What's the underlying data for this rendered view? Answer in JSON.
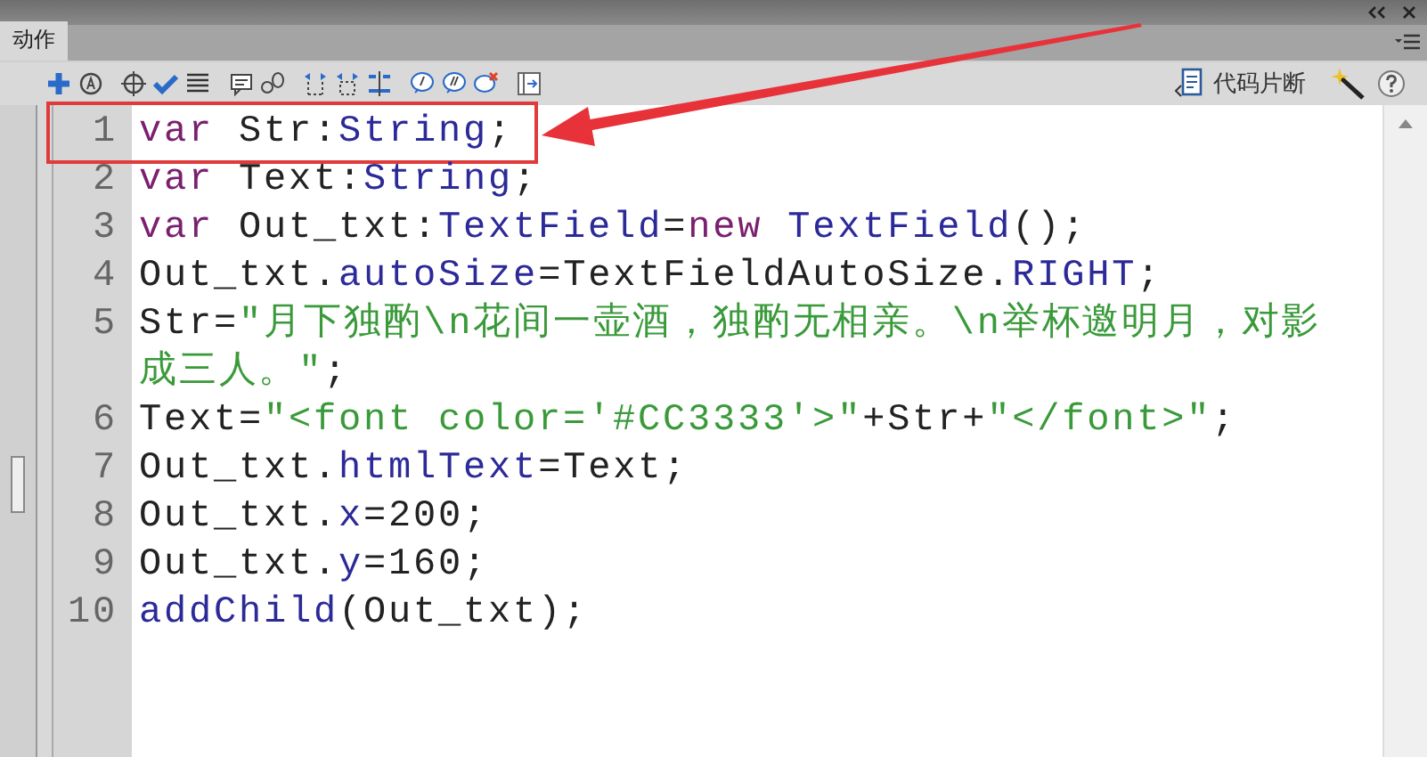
{
  "panel": {
    "tabs": [
      {
        "label": "动作",
        "selected": true
      }
    ]
  },
  "toolbar": {
    "snippets_label": "代码片断"
  },
  "editor": {
    "lines": [
      {
        "number": "1",
        "highlighted": true,
        "tokens": [
          {
            "kind": "keyword",
            "text": "var"
          },
          {
            "kind": "plain",
            "text": " Str:"
          },
          {
            "kind": "type",
            "text": "String"
          },
          {
            "kind": "plain",
            "text": ";"
          }
        ]
      },
      {
        "number": "2",
        "highlighted": false,
        "tokens": [
          {
            "kind": "keyword",
            "text": "var"
          },
          {
            "kind": "plain",
            "text": " Text:"
          },
          {
            "kind": "type",
            "text": "String"
          },
          {
            "kind": "plain",
            "text": ";"
          }
        ]
      },
      {
        "number": "3",
        "highlighted": false,
        "tokens": [
          {
            "kind": "keyword",
            "text": "var"
          },
          {
            "kind": "plain",
            "text": " Out_txt:"
          },
          {
            "kind": "type",
            "text": "TextField"
          },
          {
            "kind": "plain",
            "text": "="
          },
          {
            "kind": "keyword",
            "text": "new"
          },
          {
            "kind": "type",
            "text": " TextField"
          },
          {
            "kind": "plain",
            "text": "();"
          }
        ]
      },
      {
        "number": "4",
        "highlighted": false,
        "tokens": [
          {
            "kind": "plain",
            "text": "Out_txt."
          },
          {
            "kind": "type",
            "text": "autoSize"
          },
          {
            "kind": "plain",
            "text": "=TextFieldAutoSize."
          },
          {
            "kind": "type",
            "text": "RIGHT"
          },
          {
            "kind": "plain",
            "text": ";"
          }
        ]
      },
      {
        "number": "5",
        "highlighted": false,
        "tokens": [
          {
            "kind": "plain",
            "text": "Str="
          },
          {
            "kind": "string",
            "text": "\"月下独酌\\n花间一壶酒，独酌无相亲。\\n举杯邀明月，对影成三人。\""
          },
          {
            "kind": "plain",
            "text": ";"
          }
        ]
      },
      {
        "number": "6",
        "highlighted": false,
        "tokens": [
          {
            "kind": "plain",
            "text": "Text="
          },
          {
            "kind": "string",
            "text": "\"<font color='#CC3333'>\""
          },
          {
            "kind": "plain",
            "text": "+Str+"
          },
          {
            "kind": "string",
            "text": "\"</font>\""
          },
          {
            "kind": "plain",
            "text": ";"
          }
        ]
      },
      {
        "number": "7",
        "highlighted": false,
        "tokens": [
          {
            "kind": "plain",
            "text": "Out_txt."
          },
          {
            "kind": "type",
            "text": "htmlText"
          },
          {
            "kind": "plain",
            "text": "=Text;"
          }
        ]
      },
      {
        "number": "8",
        "highlighted": false,
        "tokens": [
          {
            "kind": "plain",
            "text": "Out_txt."
          },
          {
            "kind": "type",
            "text": "x"
          },
          {
            "kind": "plain",
            "text": "=200;"
          }
        ]
      },
      {
        "number": "9",
        "highlighted": false,
        "tokens": [
          {
            "kind": "plain",
            "text": "Out_txt."
          },
          {
            "kind": "type",
            "text": "y"
          },
          {
            "kind": "plain",
            "text": "=160;"
          }
        ]
      },
      {
        "number": "10",
        "highlighted": false,
        "tokens": [
          {
            "kind": "type",
            "text": "addChild"
          },
          {
            "kind": "plain",
            "text": "(Out_txt);"
          }
        ]
      }
    ]
  }
}
